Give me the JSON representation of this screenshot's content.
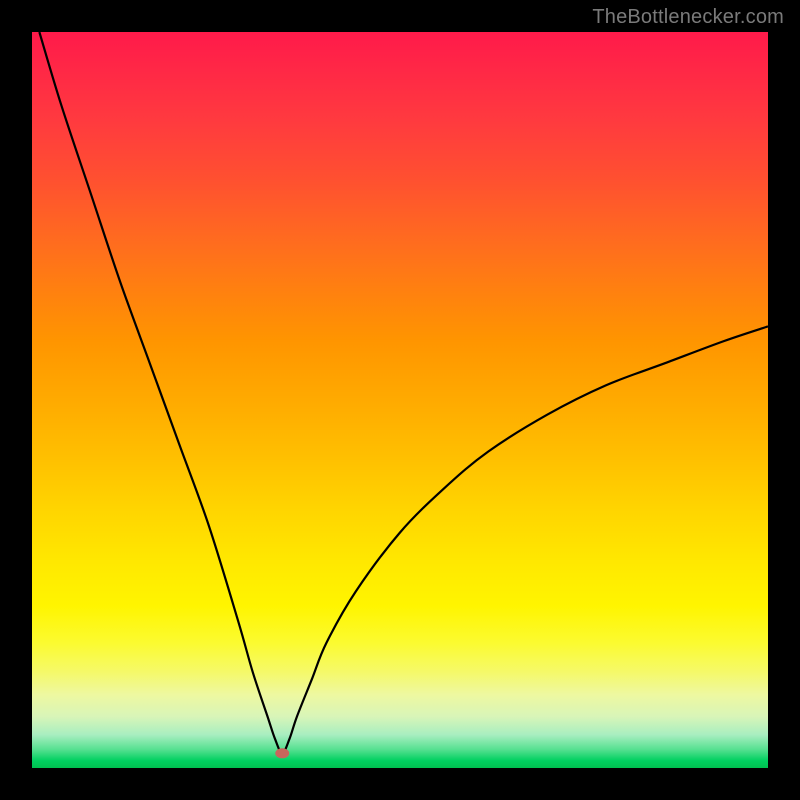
{
  "watermark": "TheBottlenecker.com",
  "chart_data": {
    "type": "line",
    "title": "",
    "xlabel": "",
    "ylabel": "",
    "xlim": [
      0,
      100
    ],
    "ylim": [
      0,
      100
    ],
    "axes_hidden": true,
    "gradient_background": {
      "top_color": "#ff1a4a",
      "bottom_color": "#00c050",
      "description": "red → orange → yellow → green vertical gradient"
    },
    "marker": {
      "x": 34,
      "y": 2,
      "color": "#c9655c"
    },
    "series": [
      {
        "name": "bottleneck-curve",
        "description": "V-shaped curve, minimum near x≈34, asymmetric: steep left branch, shallower right branch reaching ~60% height at right edge",
        "x": [
          1,
          4,
          8,
          12,
          16,
          20,
          24,
          28,
          30,
          32,
          33,
          34,
          35,
          36,
          38,
          40,
          44,
          50,
          56,
          62,
          70,
          78,
          86,
          94,
          100
        ],
        "y": [
          100,
          90,
          78,
          66,
          55,
          44,
          33,
          20,
          13,
          7,
          4,
          2,
          4,
          7,
          12,
          17,
          24,
          32,
          38,
          43,
          48,
          52,
          55,
          58,
          60
        ]
      }
    ]
  }
}
